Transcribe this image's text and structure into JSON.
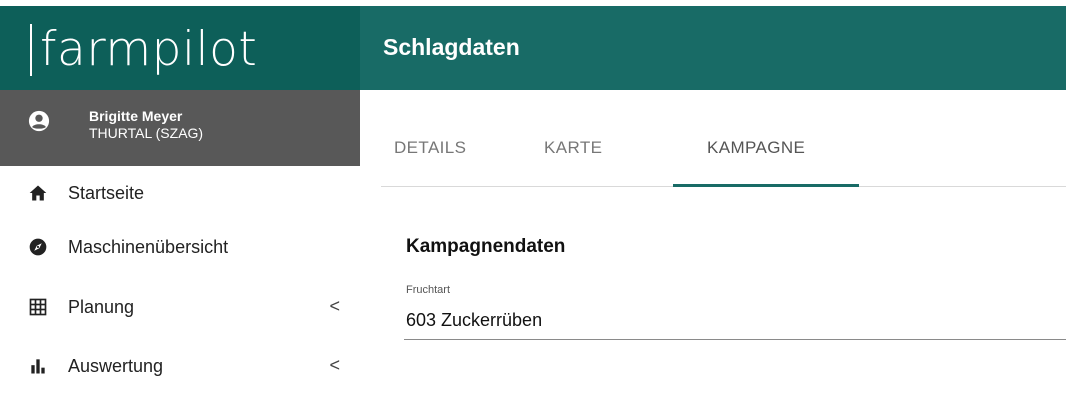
{
  "brand": {
    "logo_text": "farmpilot"
  },
  "header": {
    "title": "Schlagdaten"
  },
  "user": {
    "name": "Brigitte Meyer",
    "org": "THURTAL (SZAG)",
    "icon": "account-circle-icon"
  },
  "sidebar": {
    "items": [
      {
        "label": "Startseite",
        "icon": "home-icon"
      },
      {
        "label": "Maschinenübersicht",
        "icon": "compass-icon"
      },
      {
        "label": "Planung",
        "icon": "table-grid-icon",
        "chevron": "<"
      },
      {
        "label": "Auswertung",
        "icon": "bar-chart-icon",
        "chevron": "<"
      }
    ]
  },
  "tabs": [
    {
      "label": "DETAILS",
      "active": false
    },
    {
      "label": "KARTE",
      "active": false
    },
    {
      "label": "KAMPAGNE",
      "active": true
    }
  ],
  "main": {
    "section_title": "Kampagnendaten",
    "field": {
      "label": "Fruchtart",
      "value": "603 Zuckerrüben"
    }
  },
  "colors": {
    "brand": "#0d5f59",
    "header": "#186b66",
    "userbar": "#585858",
    "accent": "#186b66"
  }
}
